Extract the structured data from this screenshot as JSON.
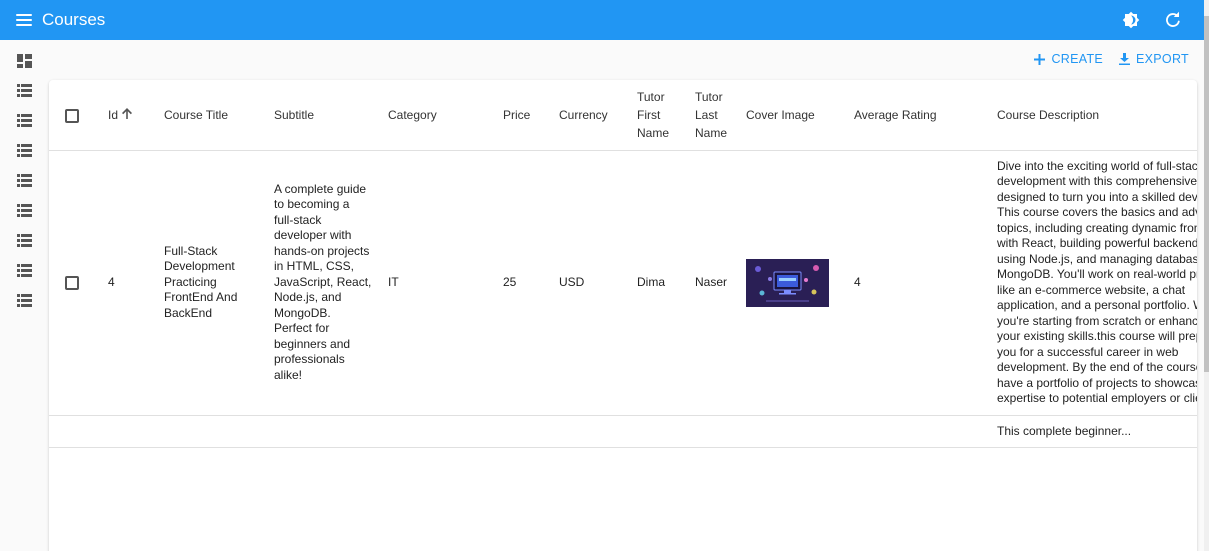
{
  "appbar": {
    "title": "Courses"
  },
  "toolbar": {
    "create_label": "CREATE",
    "export_label": "EXPORT"
  },
  "colors": {
    "primary": "#2196f3",
    "cover_bg": "#2a1f55"
  },
  "table": {
    "headers": {
      "id": "Id",
      "title": "Course Title",
      "subtitle": "Subtitle",
      "category": "Category",
      "price": "Price",
      "currency": "Currency",
      "tutor_first_name": "Tutor First Name",
      "tutor_last_name": "Tutor Last Name",
      "cover_image": "Cover Image",
      "rating": "Average Rating",
      "description": "Course Description"
    },
    "rows": [
      {
        "id": "4",
        "title": "Full-Stack Development Practicing FrontEnd And BackEnd",
        "subtitle": "A complete guide to becoming a full-stack developer with hands-on projects in HTML, CSS, JavaScript, React, Node.js, and MongoDB. Perfect for beginners and professionals alike!",
        "category": "IT",
        "price": "25",
        "currency": "USD",
        "tutor_first_name": "Dima",
        "tutor_last_name": "Naser",
        "rating": "4",
        "description": "Dive into the exciting world of full-stack development with this comprehensive course designed to turn you into a skilled developer. This course covers the basics and advanced topics, including creating dynamic frontends with React, building powerful backend APIs using Node.js, and managing databases with MongoDB. You'll work on real-world projects like an e-commerce website, a chat application, and a personal portfolio. Whether you're starting from scratch or enhancing your existing skills.this course will prepare you for a successful career in web development. By the end of the course, you'll have a portfolio of projects to showcase your expertise to potential employers or clients."
      }
    ],
    "next_row_partial": {
      "description": "This complete beginner..."
    }
  }
}
